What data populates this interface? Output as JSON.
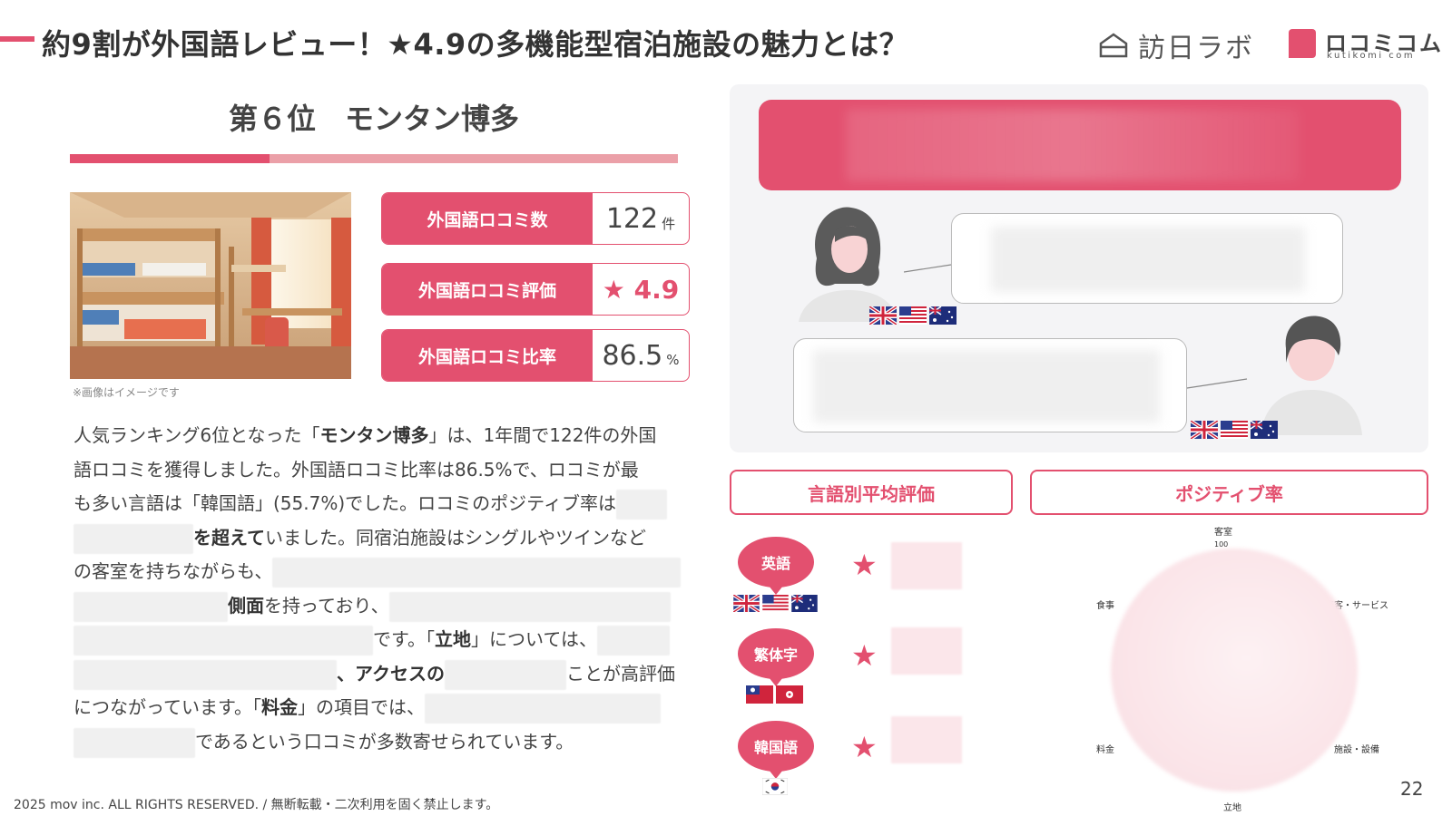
{
  "header": {
    "title": "約9割が外国語レビュー！★4.9の多機能型宿泊施設の魅力とは？",
    "logo_main": "訪日ラボ",
    "logo_sub_main": "ロコミコム",
    "logo_sub_small": "kutikomi com"
  },
  "rank": {
    "title": "第６位　モンタン博多"
  },
  "photo": {
    "note": "※画像はイメージです"
  },
  "stats": [
    {
      "label": "外国語ロコミ数",
      "value": "122",
      "unit": "件"
    },
    {
      "label": "外国語ロコミ評価",
      "value": "★ 4.9",
      "unit": ""
    },
    {
      "label": "外国語ロコミ比率",
      "value": "86.5",
      "unit": "%"
    }
  ],
  "paragraph": {
    "l1_a": "人気ランキング6位となった「",
    "l1_b": "モンタン博多",
    "l1_c": "」は、1年間で122件の外国",
    "l2": "語ロコミを獲得しました。外国語ロコミ比率は86.5%で、ロコミが最",
    "l3": "も多い言語は「韓国語」(55.7%)でした。ロコミのポジティブ率は",
    "l4_b": "を超えて",
    "l4_c": "いました。同宿泊施設はシングルやツインなど",
    "l5": "の客室を持ちながらも、",
    "l6_b": "側面",
    "l6_c": "を持っており、",
    "l7_c": "です。「",
    "l7_d": "立地",
    "l7_e": "」については、",
    "l8_b": "、アクセスの",
    "l8_c": "ことが高評価",
    "l9_a": "につながっています。「",
    "l9_b": "料金",
    "l9_c": "」の項目では、",
    "l10": "であるという口コミが多数寄せられています。"
  },
  "sections": {
    "lang_avg": "言語別平均評価",
    "positive": "ポジティブ率"
  },
  "languages": [
    {
      "name": "英語",
      "star": "★"
    },
    {
      "name": "繁体字",
      "star": "★"
    },
    {
      "name": "韓国語",
      "star": "★"
    }
  ],
  "radar": {
    "labels": {
      "top": "客室",
      "top_value": "100",
      "right_top": "接客・サービス",
      "right_bottom": "施設・設備",
      "bottom": "立地",
      "left_bottom": "料金",
      "left_top": "食事"
    }
  },
  "footer": {
    "copyright": "2025 mov inc. ALL RIGHTS RESERVED. / 無断転載・二次利用を固く禁止します。",
    "page": "22"
  },
  "colors": {
    "accent": "#e3506f",
    "accent_light": "#eba0a8"
  },
  "icons": [
    "house-logo-icon",
    "union-jack-flag-icon",
    "us-flag-icon",
    "australia-flag-icon",
    "taiwan-flag-icon",
    "hong-kong-flag-icon",
    "korea-flag-icon",
    "woman-avatar-icon",
    "man-avatar-icon"
  ]
}
